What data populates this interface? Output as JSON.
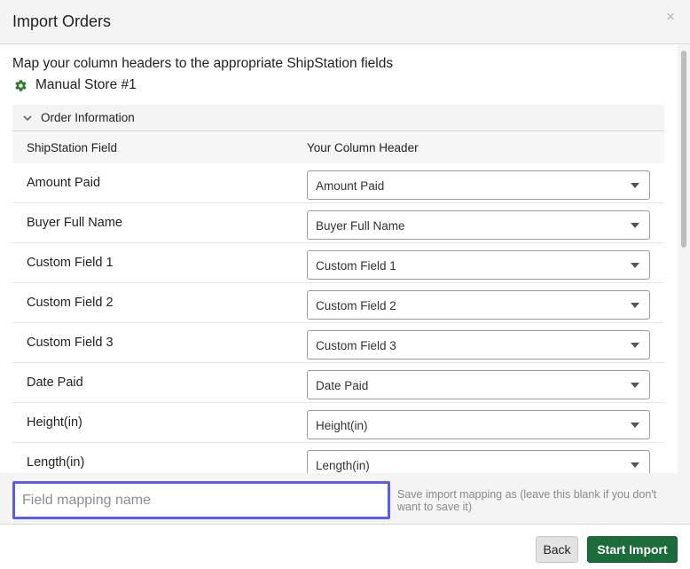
{
  "dialog": {
    "title": "Import Orders",
    "close_glyph": "×"
  },
  "intro": "Map your column headers to the appropriate ShipStation fields",
  "store": {
    "icon": "gear-icon",
    "name": "Manual Store #1"
  },
  "section": {
    "title": "Order Information",
    "expanded": true,
    "columns": [
      "ShipStation Field",
      "Your Column Header"
    ],
    "rows": [
      {
        "field": "Amount Paid",
        "mapped": "Amount Paid"
      },
      {
        "field": "Buyer Full Name",
        "mapped": "Buyer Full Name"
      },
      {
        "field": "Custom Field 1",
        "mapped": "Custom Field 1"
      },
      {
        "field": "Custom Field 2",
        "mapped": "Custom Field 2"
      },
      {
        "field": "Custom Field 3",
        "mapped": "Custom Field 3"
      },
      {
        "field": "Date Paid",
        "mapped": "Date Paid"
      },
      {
        "field": "Height(in)",
        "mapped": "Height(in)"
      },
      {
        "field": "Length(in)",
        "mapped": "Length(in)"
      }
    ]
  },
  "save_mapping": {
    "value": "",
    "placeholder": "Field mapping name",
    "hint": "Save import mapping as (leave this blank if you don't want to save it)"
  },
  "footer": {
    "back_label": "Back",
    "start_label": "Start Import"
  },
  "colors": {
    "primary": "#1c6b3a",
    "focus_ring": "#5b5ce8",
    "gear": "#2e7d32"
  }
}
